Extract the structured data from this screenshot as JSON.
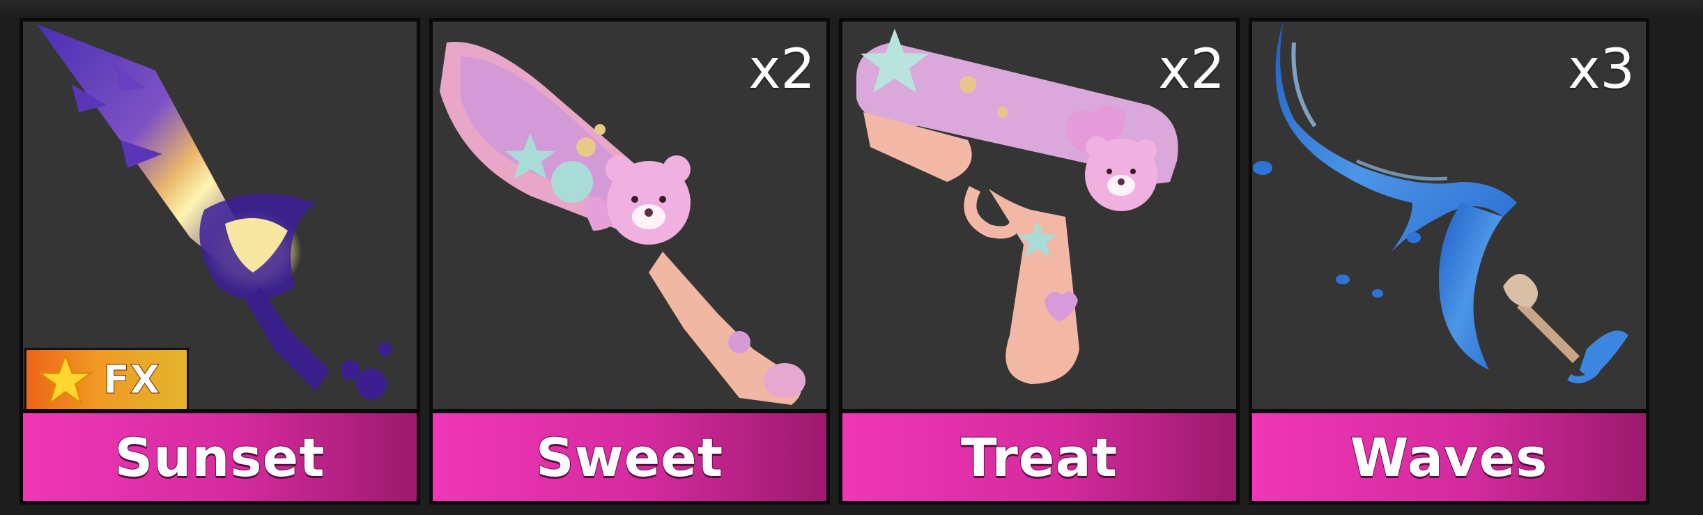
{
  "inventory": {
    "items": [
      {
        "name": "Sunset",
        "quantity": "",
        "badge": "FX",
        "badge_icon": "star-icon"
      },
      {
        "name": "Sweet",
        "quantity": "x2"
      },
      {
        "name": "Treat",
        "quantity": "x2"
      },
      {
        "name": "Waves",
        "quantity": "x3"
      }
    ]
  },
  "colors": {
    "nameplate_start": "#f037b7",
    "nameplate_end": "#9c1a6c",
    "card_background": "#353535",
    "fx_badge_start": "#ee6418",
    "fx_badge_end": "#e3b52c"
  }
}
